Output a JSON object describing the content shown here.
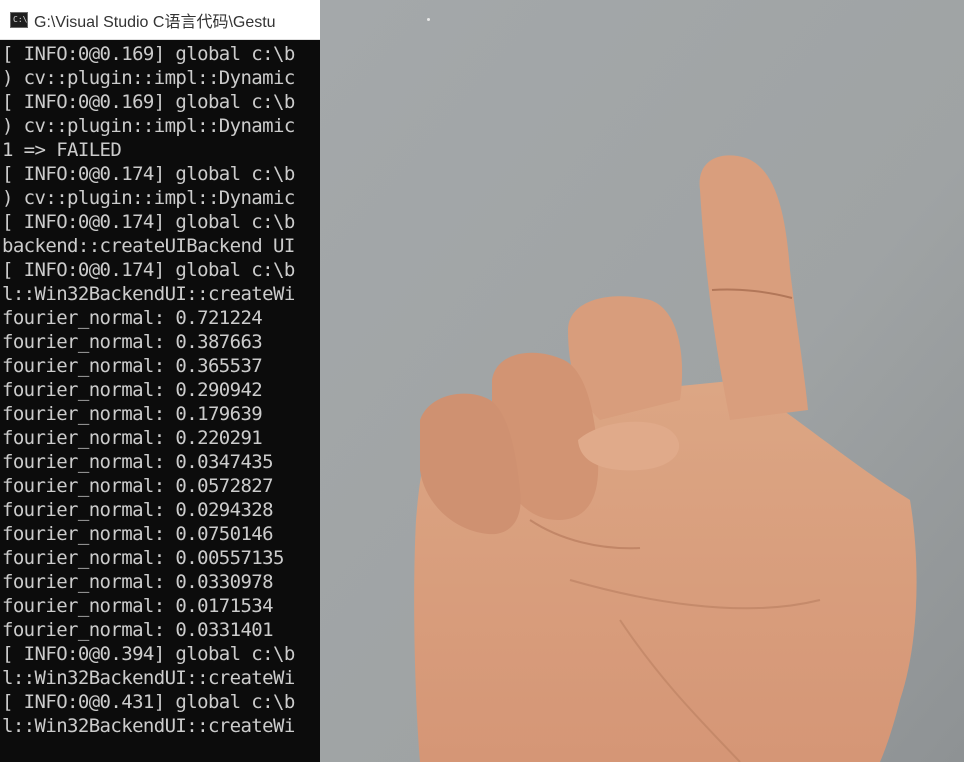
{
  "console": {
    "title": "G:\\Visual Studio C语言代码\\Gestu",
    "icon": "console-app-icon",
    "icon_text": "C:\\",
    "lines": [
      "[ INFO:0@0.169] global c:\\b",
      ") cv::plugin::impl::Dynamic",
      "[ INFO:0@0.169] global c:\\b",
      ") cv::plugin::impl::Dynamic",
      "1 => FAILED",
      "[ INFO:0@0.174] global c:\\b",
      ") cv::plugin::impl::Dynamic",
      "[ INFO:0@0.174] global c:\\b",
      "backend::createUIBackend UI",
      "[ INFO:0@0.174] global c:\\b",
      "l::Win32BackendUI::createWi",
      "fourier_normal: 0.721224",
      "fourier_normal: 0.387663",
      "fourier_normal: 0.365537",
      "fourier_normal: 0.290942",
      "fourier_normal: 0.179639",
      "fourier_normal: 0.220291",
      "fourier_normal: 0.0347435",
      "fourier_normal: 0.0572827",
      "fourier_normal: 0.0294328",
      "fourier_normal: 0.0750146",
      "fourier_normal: 0.00557135",
      "fourier_normal: 0.0330978",
      "fourier_normal: 0.0171534",
      "fourier_normal: 0.0331401",
      "[ INFO:0@0.394] global c:\\b",
      "l::Win32BackendUI::createWi",
      "[ INFO:0@0.431] global c:\\b",
      "l::Win32BackendUI::createWi"
    ],
    "colors": {
      "background": "#0c0c0c",
      "text": "#cccccc",
      "titlebar": "#ffffff"
    }
  },
  "camera": {
    "content": "hand-gesture-camera-frame",
    "colors": {
      "background": "#a7aaab",
      "skin": "#dca07e",
      "skin_shadow": "#b97a5a"
    }
  }
}
